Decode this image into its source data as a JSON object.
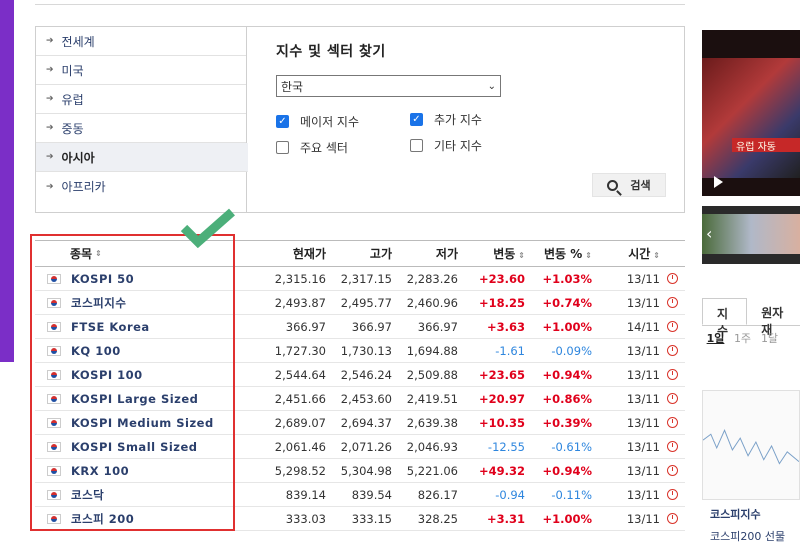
{
  "regions": [
    "전세계",
    "미국",
    "유럽",
    "중동",
    "아시아",
    "아프리카"
  ],
  "active_region": "아시아",
  "finder": {
    "title": "지수 및 섹터 찾기",
    "country": "한국",
    "options": [
      {
        "label": "메이저 지수",
        "checked": true
      },
      {
        "label": "추가 지수",
        "checked": true
      },
      {
        "label": "주요 섹터",
        "checked": false
      },
      {
        "label": "기타 지수",
        "checked": false
      }
    ],
    "search_label": "검색"
  },
  "table": {
    "headers": {
      "name": "종목",
      "price": "현재가",
      "high": "고가",
      "low": "저가",
      "change": "변동",
      "pct": "변동 %",
      "time": "시간"
    },
    "rows": [
      {
        "name": "KOSPI 50",
        "price": "2,315.16",
        "high": "2,317.15",
        "low": "2,283.26",
        "change": "+23.60",
        "pct": "+1.03%",
        "time": "13/11",
        "dir": "up"
      },
      {
        "name": "코스피지수",
        "price": "2,493.87",
        "high": "2,495.77",
        "low": "2,460.96",
        "change": "+18.25",
        "pct": "+0.74%",
        "time": "13/11",
        "dir": "up"
      },
      {
        "name": "FTSE Korea",
        "price": "366.97",
        "high": "366.97",
        "low": "366.97",
        "change": "+3.63",
        "pct": "+1.00%",
        "time": "14/11",
        "dir": "up"
      },
      {
        "name": "KQ 100",
        "price": "1,727.30",
        "high": "1,730.13",
        "low": "1,694.88",
        "change": "-1.61",
        "pct": "-0.09%",
        "time": "13/11",
        "dir": "down"
      },
      {
        "name": "KOSPI 100",
        "price": "2,544.64",
        "high": "2,546.24",
        "low": "2,509.88",
        "change": "+23.65",
        "pct": "+0.94%",
        "time": "13/11",
        "dir": "up"
      },
      {
        "name": "KOSPI Large Sized",
        "price": "2,451.66",
        "high": "2,453.60",
        "low": "2,419.51",
        "change": "+20.97",
        "pct": "+0.86%",
        "time": "13/11",
        "dir": "up"
      },
      {
        "name": "KOSPI Medium Sized",
        "price": "2,689.07",
        "high": "2,694.37",
        "low": "2,639.38",
        "change": "+10.35",
        "pct": "+0.39%",
        "time": "13/11",
        "dir": "up"
      },
      {
        "name": "KOSPI Small Sized",
        "price": "2,061.46",
        "high": "2,071.26",
        "low": "2,046.93",
        "change": "-12.55",
        "pct": "-0.61%",
        "time": "13/11",
        "dir": "down"
      },
      {
        "name": "KRX 100",
        "price": "5,298.52",
        "high": "5,304.98",
        "low": "5,221.06",
        "change": "+49.32",
        "pct": "+0.94%",
        "time": "13/11",
        "dir": "up"
      },
      {
        "name": "코스닥",
        "price": "839.14",
        "high": "839.54",
        "low": "826.17",
        "change": "-0.94",
        "pct": "-0.11%",
        "time": "13/11",
        "dir": "down"
      },
      {
        "name": "코스피 200",
        "price": "333.03",
        "high": "333.15",
        "low": "328.25",
        "change": "+3.31",
        "pct": "+1.00%",
        "time": "13/11",
        "dir": "up"
      }
    ]
  },
  "sidebar": {
    "video1_banner": "유럽 자동",
    "tabs": [
      "지수",
      "원자재"
    ],
    "periods": [
      "1일",
      "1주",
      "1달"
    ],
    "label1": "코스피지수",
    "label2": "코스피200 선물"
  },
  "colors": {
    "accent": "#7b2ec7",
    "up": "#e0001b",
    "down": "#2e86de",
    "highlight_frame": "#e03030",
    "checkmark": "#4caf7a"
  }
}
